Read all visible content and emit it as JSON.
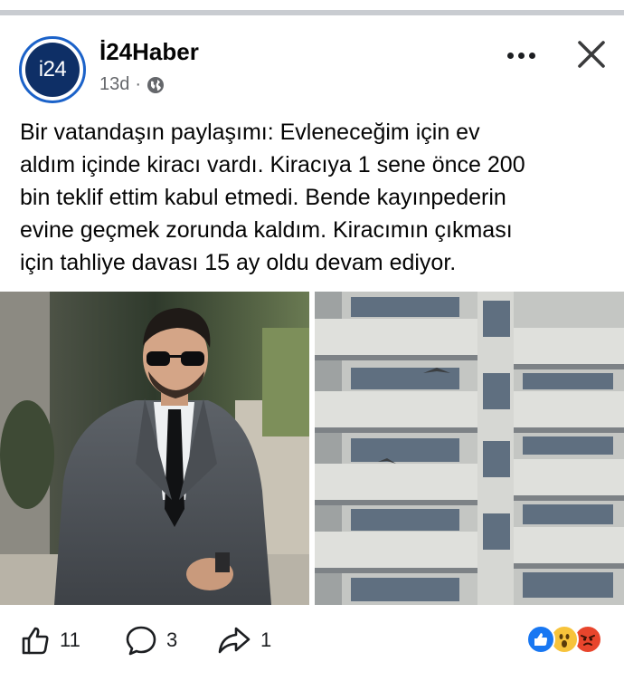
{
  "post": {
    "page_name": "İ24Haber",
    "avatar_text": "i24",
    "time_ago": "13d",
    "separator": "·",
    "privacy_icon": "globe-icon",
    "text_lines": [
      "Bir vatandaşın paylaşımı: Evleneceğim için ev",
      "aldım içinde kiracı vardı. Kiracıya 1 sene önce 200",
      "bin teklif ettim kabul etmedi. Bende kayınpederin",
      "evine geçmek zorunda kaldım. Kiracımın çıkması",
      "için tahliye davası 15 ay oldu devam ediyor."
    ]
  },
  "actions": {
    "like_count": "11",
    "comment_count": "3",
    "share_count": "1",
    "like_icon": "thumbs-up-icon",
    "comment_icon": "comment-bubble-icon",
    "share_icon": "share-arrow-icon",
    "reactions": [
      "like",
      "wow",
      "angry"
    ]
  },
  "colors": {
    "brand_blue": "#1b62c9",
    "avatar_dark": "#0e2f66",
    "meta_gray": "#65676b",
    "like_blue": "#1877f2",
    "wow_yellow": "#f7c33b",
    "angry_red": "#e8452c"
  }
}
